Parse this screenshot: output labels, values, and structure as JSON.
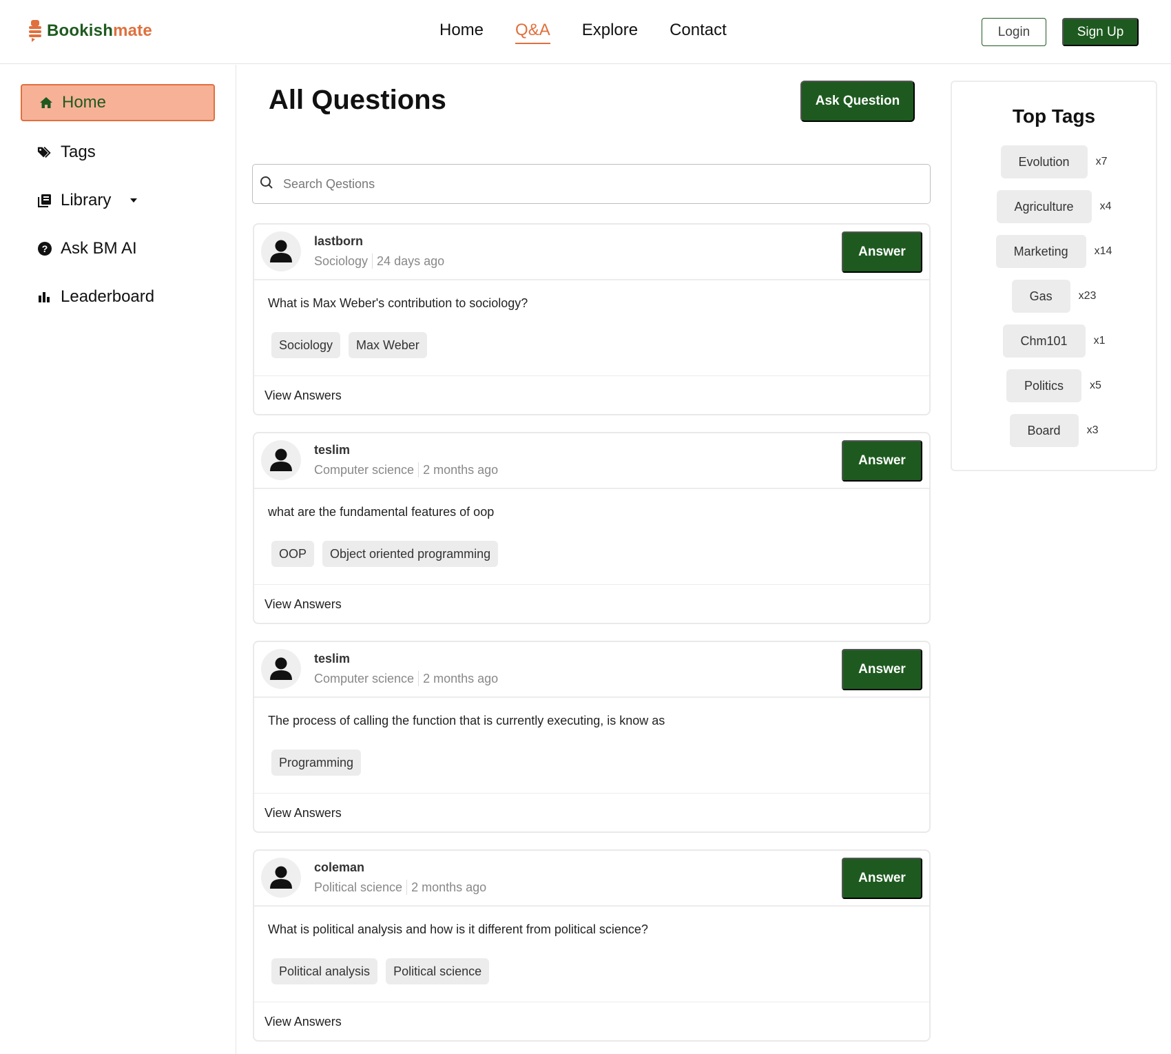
{
  "brand": {
    "name_part1": "Bookish",
    "name_part2": "mate",
    "primary_color": "#1e5a1f",
    "accent_color": "#e0703d"
  },
  "topnav": {
    "items": [
      {
        "label": "Home"
      },
      {
        "label": "Q&A",
        "active": true
      },
      {
        "label": "Explore"
      },
      {
        "label": "Contact"
      }
    ],
    "login_label": "Login",
    "signup_label": "Sign Up"
  },
  "sidebar": {
    "items": [
      {
        "label": "Home",
        "icon": "home-icon",
        "active": true
      },
      {
        "label": "Tags",
        "icon": "tags-icon"
      },
      {
        "label": "Library",
        "icon": "library-icon",
        "has_dropdown": true
      },
      {
        "label": "Ask BM AI",
        "icon": "question-circle-icon"
      },
      {
        "label": "Leaderboard",
        "icon": "bar-chart-icon"
      }
    ]
  },
  "main": {
    "title": "All Questions",
    "ask_button_label": "Ask Question",
    "search_placeholder": "Search Qestions"
  },
  "questions": [
    {
      "user": "lastborn",
      "category": "Sociology",
      "time": "24 days ago",
      "answer_label": "Answer",
      "text": "What is Max Weber's contribution to sociology?",
      "tags": [
        "Sociology",
        "Max Weber"
      ],
      "view_label": "View Answers"
    },
    {
      "user": "teslim",
      "category": "Computer science",
      "time": "2 months ago",
      "answer_label": "Answer",
      "text": "what are the fundamental features of oop",
      "tags": [
        "OOP",
        "Object oriented programming"
      ],
      "view_label": "View Answers"
    },
    {
      "user": "teslim",
      "category": "Computer science",
      "time": "2 months ago",
      "answer_label": "Answer",
      "text": "The process of calling the function that is currently executing, is know as",
      "tags": [
        "Programming"
      ],
      "view_label": "View Answers"
    },
    {
      "user": "coleman",
      "category": "Political science",
      "time": "2 months ago",
      "answer_label": "Answer",
      "text": "What is political analysis and how is it different from political science?",
      "tags": [
        "Political analysis",
        "Political science"
      ],
      "view_label": "View Answers"
    }
  ],
  "top_tags": {
    "title": "Top Tags",
    "items": [
      {
        "name": "Evolution",
        "count": "x7"
      },
      {
        "name": "Agriculture",
        "count": "x4"
      },
      {
        "name": "Marketing",
        "count": "x14"
      },
      {
        "name": "Gas",
        "count": "x23"
      },
      {
        "name": "Chm101",
        "count": "x1"
      },
      {
        "name": "Politics",
        "count": "x5"
      },
      {
        "name": "Board",
        "count": "x3"
      }
    ]
  }
}
